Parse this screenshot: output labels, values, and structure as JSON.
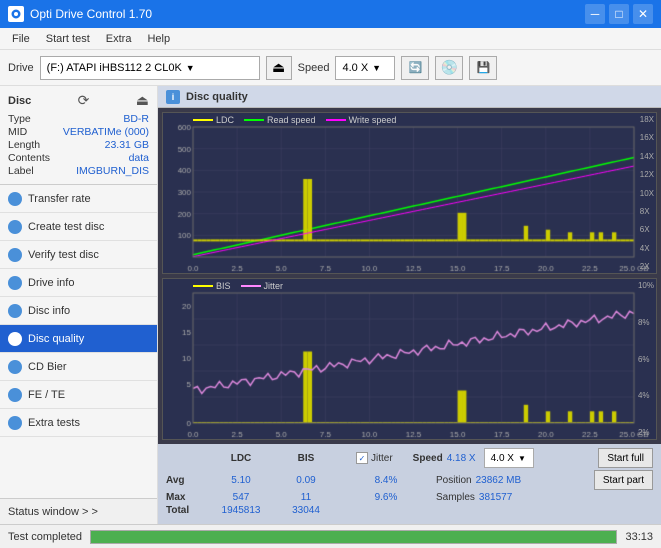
{
  "app": {
    "title": "Opti Drive Control 1.70",
    "icon": "💿"
  },
  "titlebar": {
    "minimize": "─",
    "maximize": "□",
    "close": "✕"
  },
  "menu": {
    "items": [
      "File",
      "Start test",
      "Extra",
      "Help"
    ]
  },
  "toolbar": {
    "drive_label": "Drive",
    "drive_value": "(F:)  ATAPI iHBS112  2 CL0K",
    "speed_label": "Speed",
    "speed_value": "4.0 X"
  },
  "disc": {
    "label": "Disc",
    "type_label": "Type",
    "type_value": "BD-R",
    "mid_label": "MID",
    "mid_value": "VERBATIMe (000)",
    "length_label": "Length",
    "length_value": "23.31 GB",
    "contents_label": "Contents",
    "contents_value": "data",
    "disc_label_label": "Label",
    "disc_label_value": "IMGBURN_DIS"
  },
  "sidebar": {
    "items": [
      {
        "id": "transfer-rate",
        "label": "Transfer rate",
        "active": false
      },
      {
        "id": "create-test-disc",
        "label": "Create test disc",
        "active": false
      },
      {
        "id": "verify-test-disc",
        "label": "Verify test disc",
        "active": false
      },
      {
        "id": "drive-info",
        "label": "Drive info",
        "active": false
      },
      {
        "id": "disc-info",
        "label": "Disc info",
        "active": false
      },
      {
        "id": "disc-quality",
        "label": "Disc quality",
        "active": true
      },
      {
        "id": "cd-bier",
        "label": "CD Bier",
        "active": false
      },
      {
        "id": "fe-te",
        "label": "FE / TE",
        "active": false
      },
      {
        "id": "extra-tests",
        "label": "Extra tests",
        "active": false
      }
    ],
    "status_window": "Status window > >"
  },
  "disc_quality": {
    "title": "Disc quality",
    "chart1": {
      "legend": [
        {
          "label": "LDC",
          "color": "#ffff00"
        },
        {
          "label": "Read speed",
          "color": "#00ff00"
        },
        {
          "label": "Write speed",
          "color": "#ff00ff"
        }
      ],
      "left_axis": [
        "600",
        "500",
        "400",
        "300",
        "200",
        "100"
      ],
      "right_axis": [
        "18X",
        "16X",
        "14X",
        "12X",
        "10X",
        "8X",
        "6X",
        "4X",
        "2X"
      ],
      "bottom_axis": [
        "0.0",
        "2.5",
        "5.0",
        "7.5",
        "10.0",
        "12.5",
        "15.0",
        "17.5",
        "20.0",
        "22.5",
        "25.0 GB"
      ]
    },
    "chart2": {
      "legend": [
        {
          "label": "BIS",
          "color": "#ffff00"
        },
        {
          "label": "Jitter",
          "color": "#ff88ff"
        }
      ],
      "left_axis": [
        "20",
        "15",
        "10",
        "5"
      ],
      "right_axis": [
        "10%",
        "8%",
        "6%",
        "4%",
        "2%"
      ],
      "bottom_axis": [
        "0.0",
        "2.5",
        "5.0",
        "7.5",
        "10.0",
        "12.5",
        "15.0",
        "17.5",
        "20.0",
        "22.5",
        "25.0 GB"
      ]
    }
  },
  "stats": {
    "headers": [
      "LDC",
      "BIS",
      "",
      "Jitter",
      "Speed",
      "",
      ""
    ],
    "avg_label": "Avg",
    "max_label": "Max",
    "total_label": "Total",
    "ldc_avg": "5.10",
    "ldc_max": "547",
    "ldc_total": "1945813",
    "bis_avg": "0.09",
    "bis_max": "11",
    "bis_total": "33044",
    "jitter_avg": "8.4%",
    "jitter_max": "9.6%",
    "speed_label": "Speed",
    "speed_value": "4.18 X",
    "speed_select": "4.0 X",
    "position_label": "Position",
    "position_value": "23862 MB",
    "samples_label": "Samples",
    "samples_value": "381577",
    "start_full": "Start full",
    "start_part": "Start part"
  },
  "bottom": {
    "status": "Test completed",
    "progress": 100,
    "time": "33:13"
  }
}
